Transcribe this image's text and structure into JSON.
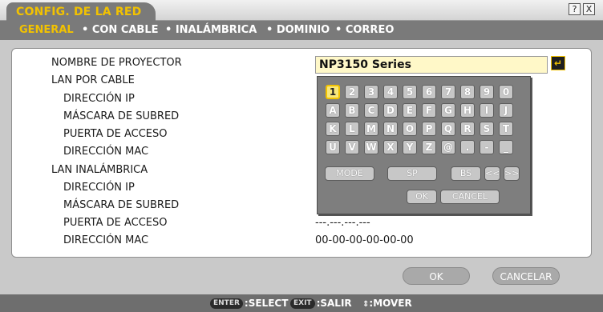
{
  "window": {
    "title": "CONFIG. DE LA RED",
    "help_label": "?",
    "close_label": "X"
  },
  "tabs": [
    {
      "label": "GENERAL",
      "active": true
    },
    {
      "label": "• CON CABLE",
      "active": false
    },
    {
      "label": "• INALÁMBRICA",
      "active": false
    },
    {
      "label": "• DOMINIO",
      "active": false
    },
    {
      "label": "• CORREO",
      "active": false
    }
  ],
  "form": {
    "projector_name_label": "NOMBRE DE PROYECTOR",
    "projector_name_value": "NP3150 Series",
    "wired_section": "LAN POR CABLE",
    "wired": {
      "ip_label": "DIRECCIÓN IP",
      "mask_label": "MÁSCARA DE SUBRED",
      "gateway_label": "PUERTA DE ACCESO",
      "mac_label": "DIRECCIÓN MAC"
    },
    "wireless_section": "LAN INALÁMBRICA",
    "wireless": {
      "ip_label": "DIRECCIÓN IP",
      "mask_label": "MÁSCARA DE SUBRED",
      "gateway_label": "PUERTA DE ACCESO",
      "gateway_value": "---.---.---.---",
      "mac_label": "DIRECCIÓN MAC",
      "mac_value": "00-00-00-00-00-00"
    }
  },
  "keyboard": {
    "rows": [
      [
        "1",
        "2",
        "3",
        "4",
        "5",
        "6",
        "7",
        "8",
        "9",
        "0"
      ],
      [
        "A",
        "B",
        "C",
        "D",
        "E",
        "F",
        "G",
        "H",
        "I",
        "J"
      ],
      [
        "K",
        "L",
        "M",
        "N",
        "O",
        "P",
        "Q",
        "R",
        "S",
        "T"
      ],
      [
        "U",
        "V",
        "W",
        "X",
        "Y",
        "Z",
        "@",
        ".",
        "-",
        "_"
      ]
    ],
    "selected_key": "1",
    "mode_label": "MODE",
    "sp_label": "SP",
    "bs_label": "BS",
    "left_label": "<<",
    "right_label": ">>",
    "ok_label": "OK",
    "cancel_label": "CANCEL"
  },
  "actions": {
    "ok_label": "OK",
    "cancel_label": "CANCELAR"
  },
  "footer": {
    "enter_key": "ENTER",
    "enter_label": ":SELECT",
    "exit_key": "EXIT",
    "exit_label": ":SALIR",
    "move_label": ":MOVER"
  },
  "colors": {
    "accent": "#f2c200",
    "panel": "#ffffff",
    "tabbar": "#7a7a7a"
  }
}
